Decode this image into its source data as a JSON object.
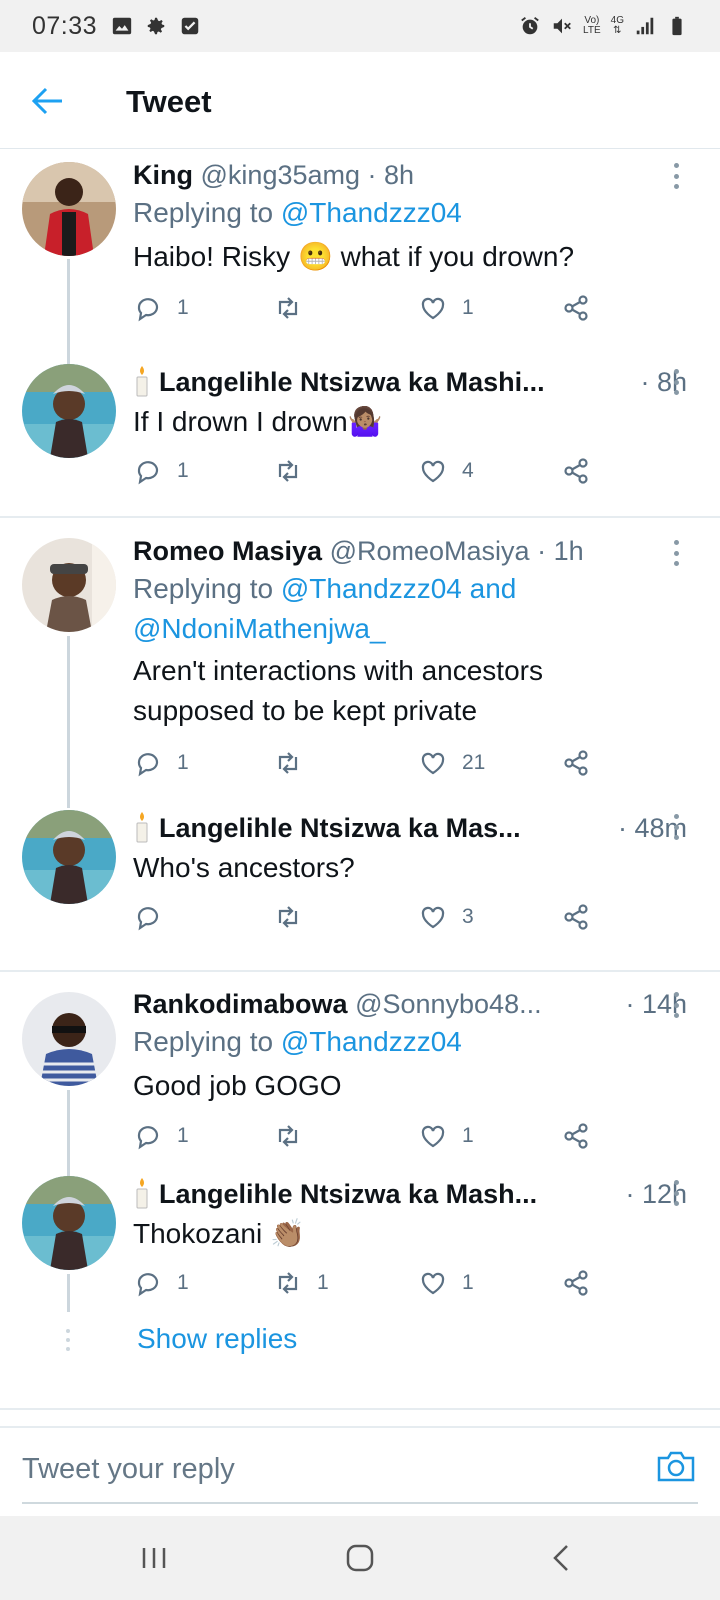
{
  "status_bar": {
    "time": "07:33",
    "network": "4G",
    "volte_top": "Vo)",
    "volte_bottom": "LTE"
  },
  "header": {
    "title": "Tweet"
  },
  "tweets": [
    {
      "name": "King",
      "handle": "@king35amg",
      "time": "· 8h",
      "replying_label": "Replying to",
      "mentions": "@Thandzzz04",
      "text": "Haibo! Risky 😬 what if you drown?",
      "replies": "1",
      "retweets": "",
      "likes": "1"
    },
    {
      "name": "Langelihle Ntsizwa ka Mashi...",
      "handle": "",
      "time": "· 8h",
      "text": "If I drown I drown🤷🏽‍♀️",
      "replies": "1",
      "retweets": "",
      "likes": "4"
    },
    {
      "name": "Romeo Masiya",
      "handle": "@RomeoMasiya",
      "time": "· 1h",
      "replying_label": "Replying to",
      "mentions_line1": "@Thandzzz04 and",
      "mentions_line2": "@NdoniMathenjwa_",
      "text_line1": "Aren't interactions with ancestors",
      "text_line2": "supposed to be kept private",
      "replies": "1",
      "retweets": "",
      "likes": "21"
    },
    {
      "name": "Langelihle Ntsizwa ka Mas...",
      "handle": "",
      "time": "· 48m",
      "text": "Who's ancestors?",
      "replies": "",
      "retweets": "",
      "likes": "3"
    },
    {
      "name": "Rankodimabowa",
      "handle": "@Sonnybo48...",
      "time": "· 14h",
      "replying_label": "Replying to",
      "mentions": "@Thandzzz04",
      "text": "Good job GOGO",
      "replies": "1",
      "retweets": "",
      "likes": "1"
    },
    {
      "name": "Langelihle Ntsizwa ka Mash...",
      "handle": "",
      "time": "· 12h",
      "text": "Thokozani 👏🏽",
      "replies": "1",
      "retweets": "1",
      "likes": "1"
    }
  ],
  "show_replies": "Show replies",
  "composer": {
    "placeholder": "Tweet your reply"
  },
  "colors": {
    "accent": "#1b95e0",
    "muted": "#5b7083",
    "divider": "#e6ecf0"
  },
  "icons": [
    "back-arrow-icon",
    "reply-icon",
    "retweet-icon",
    "like-icon",
    "share-icon",
    "more-icon",
    "camera-icon",
    "candle-icon"
  ]
}
